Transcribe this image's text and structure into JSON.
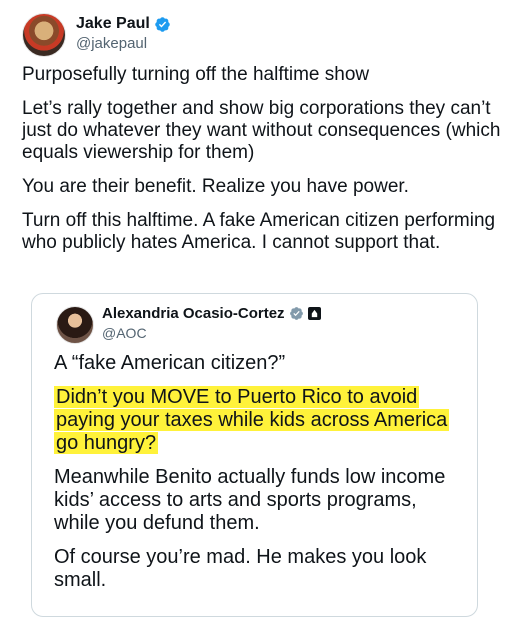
{
  "tweet": {
    "author": {
      "name": "Jake Paul",
      "handle": "@jakepaul",
      "verified_icon": "verified-badge-icon",
      "badge_color": "#1d9bf0"
    },
    "paragraphs": [
      "Purposefully turning off the halftime show",
      "Let’s rally together and show big corporations they can’t just do whatever they want without consequences (which equals viewership for them)",
      "You are their benefit. Realize you have power.",
      "Turn off this halftime. A fake American citizen performing who publicly hates America. I cannot support that."
    ]
  },
  "quote": {
    "author": {
      "name": "Alexandria Ocasio-Cortez",
      "handle": "@AOC",
      "verified_icon": "verified-badge-icon",
      "badge_color": "#829aab",
      "gov_icon": "government-badge-icon"
    },
    "p1": "A “fake American citizen?”",
    "p2_highlighted": "Didn’t you MOVE to Puerto Rico to avoid paying your taxes while kids across America go hungry?",
    "highlight_color": "#fff23a",
    "p3": "Meanwhile Benito actually funds low income kids’ access to arts and sports programs, while you defund them.",
    "p4": "Of course you’re mad. He makes you look small."
  }
}
